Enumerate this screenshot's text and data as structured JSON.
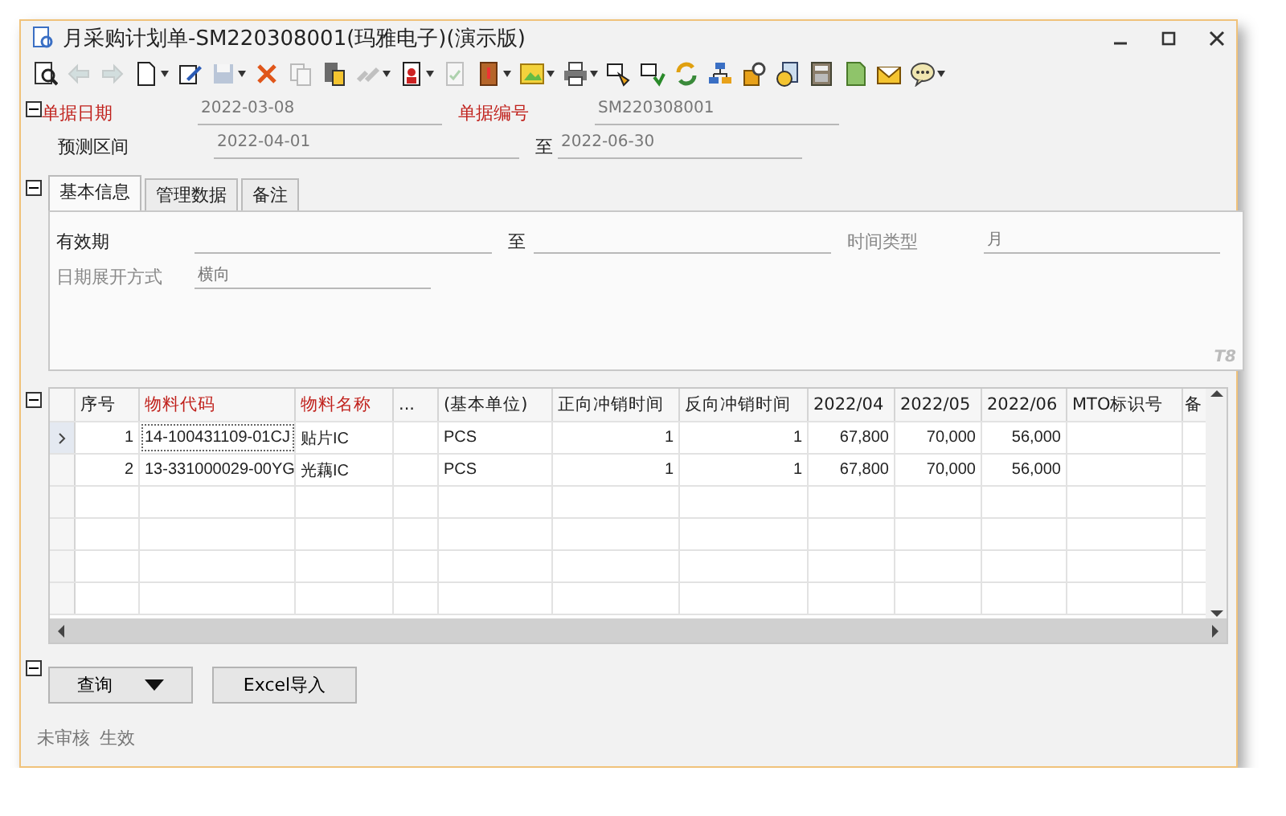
{
  "window": {
    "title": "月采购计划单-SM220308001(玛雅电子)(演示版)"
  },
  "toolbar": [
    {
      "kind": "preview",
      "disabled": false,
      "menu": false
    },
    {
      "kind": "back",
      "disabled": true,
      "menu": false
    },
    {
      "kind": "forward",
      "disabled": true,
      "menu": false
    },
    {
      "kind": "new",
      "disabled": false,
      "menu": true
    },
    {
      "kind": "edit",
      "disabled": false,
      "menu": false
    },
    {
      "kind": "save",
      "disabled": true,
      "menu": true
    },
    {
      "kind": "delete",
      "disabled": false,
      "menu": false
    },
    {
      "kind": "copy",
      "disabled": true,
      "menu": false
    },
    {
      "kind": "paste",
      "disabled": false,
      "menu": false
    },
    {
      "kind": "link",
      "disabled": true,
      "menu": true
    },
    {
      "kind": "person",
      "disabled": false,
      "menu": true
    },
    {
      "kind": "check",
      "disabled": true,
      "menu": false
    },
    {
      "kind": "book",
      "disabled": false,
      "menu": true
    },
    {
      "kind": "image",
      "disabled": false,
      "menu": true
    },
    {
      "kind": "print",
      "disabled": false,
      "menu": true
    },
    {
      "kind": "push",
      "disabled": false,
      "menu": false
    },
    {
      "kind": "pull",
      "disabled": false,
      "menu": false
    },
    {
      "kind": "refresh",
      "disabled": false,
      "menu": false
    },
    {
      "kind": "flow",
      "disabled": false,
      "menu": false
    },
    {
      "kind": "find",
      "disabled": false,
      "menu": false
    },
    {
      "kind": "clock",
      "disabled": false,
      "menu": false
    },
    {
      "kind": "calculator",
      "disabled": false,
      "menu": false
    },
    {
      "kind": "sheet",
      "disabled": false,
      "menu": false
    },
    {
      "kind": "mail",
      "disabled": false,
      "menu": false
    },
    {
      "kind": "chat",
      "disabled": false,
      "menu": true
    }
  ],
  "header": {
    "expanded": true,
    "rows": [
      [
        {
          "label": "单据日期",
          "required": true,
          "value": "2022-03-08"
        },
        {
          "label": "单据编号",
          "required": true,
          "value": "SM220308001"
        }
      ],
      [
        {
          "label": "预测区间",
          "required": false,
          "value": "2022-04-01"
        },
        {
          "label": "至",
          "required": false,
          "value": "2022-06-30"
        }
      ]
    ]
  },
  "tabs_section": {
    "expanded": true,
    "tabs": [
      {
        "label": "基本信息",
        "selected": true
      },
      {
        "label": "管理数据",
        "selected": false
      },
      {
        "label": "备注",
        "selected": false
      }
    ],
    "fields": [
      [
        {
          "label": "有效期",
          "disabled": false
        },
        {
          "label": "至",
          "disabled": false
        },
        {
          "label": "时间类型",
          "disabled": true,
          "value": "月"
        }
      ],
      [
        {
          "label": "日期展开方式",
          "disabled": true,
          "value": "横向"
        }
      ]
    ],
    "logo_text": "T8"
  },
  "grid": {
    "expanded": true,
    "columns": [
      {
        "label": "序号",
        "required": false,
        "kind": "number"
      },
      {
        "label": "物料代码",
        "required": true,
        "kind": "text"
      },
      {
        "label": "物料名称",
        "required": true,
        "kind": "text"
      },
      {
        "label": "...",
        "required": false,
        "kind": "text"
      },
      {
        "label": "(基本单位)",
        "required": false,
        "kind": "text"
      },
      {
        "label": "正向冲销时间",
        "required": false,
        "kind": "number"
      },
      {
        "label": "反向冲销时间",
        "required": false,
        "kind": "number"
      },
      {
        "label": "2022/04",
        "required": false,
        "kind": "number"
      },
      {
        "label": "2022/05",
        "required": false,
        "kind": "number"
      },
      {
        "label": "2022/06",
        "required": false,
        "kind": "number"
      },
      {
        "label": "MTO标识号",
        "required": false,
        "kind": "text"
      },
      {
        "label": "备",
        "required": false,
        "kind": "text"
      }
    ],
    "rows": [
      {
        "selected": true,
        "cells": [
          "1",
          "14-100431109-01CJ",
          "贴片IC",
          null,
          "PCS",
          "1",
          "1",
          "67,800",
          "70,000",
          "56,000",
          null,
          null
        ]
      },
      {
        "selected": false,
        "cells": [
          "2",
          "13-331000029-00YG",
          "光藕IC",
          null,
          "PCS",
          "1",
          "1",
          "67,800",
          "70,000",
          "56,000",
          null,
          null
        ]
      }
    ]
  },
  "actions": {
    "expanded": true,
    "buttons": [
      {
        "label": "查询",
        "menu": true
      },
      {
        "label": "Excel导入",
        "menu": false
      }
    ]
  },
  "status": [
    "未审核",
    "生效"
  ]
}
